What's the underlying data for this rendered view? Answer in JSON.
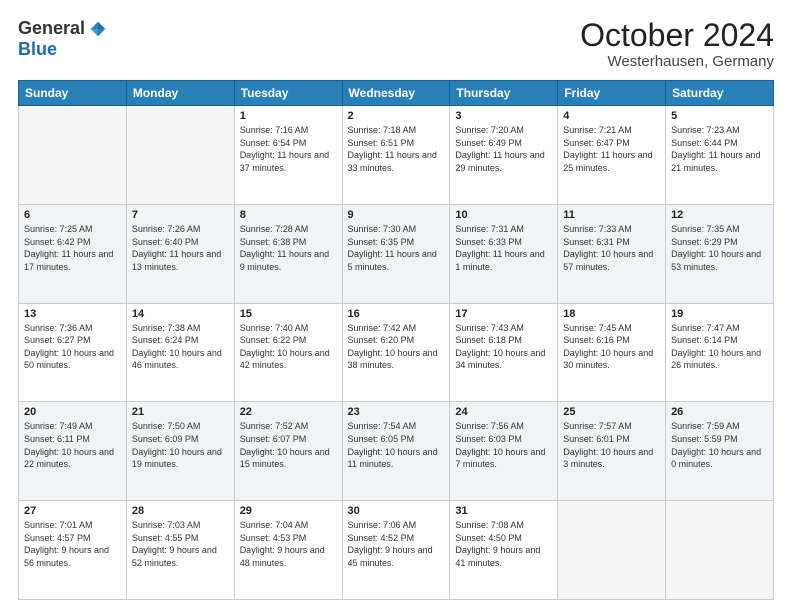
{
  "logo": {
    "general": "General",
    "blue": "Blue"
  },
  "title": "October 2024",
  "subtitle": "Westerhausen, Germany",
  "days_of_week": [
    "Sunday",
    "Monday",
    "Tuesday",
    "Wednesday",
    "Thursday",
    "Friday",
    "Saturday"
  ],
  "weeks": [
    [
      {
        "day": "",
        "info": ""
      },
      {
        "day": "",
        "info": ""
      },
      {
        "day": "1",
        "info": "Sunrise: 7:16 AM\nSunset: 6:54 PM\nDaylight: 11 hours and 37 minutes."
      },
      {
        "day": "2",
        "info": "Sunrise: 7:18 AM\nSunset: 6:51 PM\nDaylight: 11 hours and 33 minutes."
      },
      {
        "day": "3",
        "info": "Sunrise: 7:20 AM\nSunset: 6:49 PM\nDaylight: 11 hours and 29 minutes."
      },
      {
        "day": "4",
        "info": "Sunrise: 7:21 AM\nSunset: 6:47 PM\nDaylight: 11 hours and 25 minutes."
      },
      {
        "day": "5",
        "info": "Sunrise: 7:23 AM\nSunset: 6:44 PM\nDaylight: 11 hours and 21 minutes."
      }
    ],
    [
      {
        "day": "6",
        "info": "Sunrise: 7:25 AM\nSunset: 6:42 PM\nDaylight: 11 hours and 17 minutes."
      },
      {
        "day": "7",
        "info": "Sunrise: 7:26 AM\nSunset: 6:40 PM\nDaylight: 11 hours and 13 minutes."
      },
      {
        "day": "8",
        "info": "Sunrise: 7:28 AM\nSunset: 6:38 PM\nDaylight: 11 hours and 9 minutes."
      },
      {
        "day": "9",
        "info": "Sunrise: 7:30 AM\nSunset: 6:35 PM\nDaylight: 11 hours and 5 minutes."
      },
      {
        "day": "10",
        "info": "Sunrise: 7:31 AM\nSunset: 6:33 PM\nDaylight: 11 hours and 1 minute."
      },
      {
        "day": "11",
        "info": "Sunrise: 7:33 AM\nSunset: 6:31 PM\nDaylight: 10 hours and 57 minutes."
      },
      {
        "day": "12",
        "info": "Sunrise: 7:35 AM\nSunset: 6:29 PM\nDaylight: 10 hours and 53 minutes."
      }
    ],
    [
      {
        "day": "13",
        "info": "Sunrise: 7:36 AM\nSunset: 6:27 PM\nDaylight: 10 hours and 50 minutes."
      },
      {
        "day": "14",
        "info": "Sunrise: 7:38 AM\nSunset: 6:24 PM\nDaylight: 10 hours and 46 minutes."
      },
      {
        "day": "15",
        "info": "Sunrise: 7:40 AM\nSunset: 6:22 PM\nDaylight: 10 hours and 42 minutes."
      },
      {
        "day": "16",
        "info": "Sunrise: 7:42 AM\nSunset: 6:20 PM\nDaylight: 10 hours and 38 minutes."
      },
      {
        "day": "17",
        "info": "Sunrise: 7:43 AM\nSunset: 6:18 PM\nDaylight: 10 hours and 34 minutes."
      },
      {
        "day": "18",
        "info": "Sunrise: 7:45 AM\nSunset: 6:16 PM\nDaylight: 10 hours and 30 minutes."
      },
      {
        "day": "19",
        "info": "Sunrise: 7:47 AM\nSunset: 6:14 PM\nDaylight: 10 hours and 26 minutes."
      }
    ],
    [
      {
        "day": "20",
        "info": "Sunrise: 7:49 AM\nSunset: 6:11 PM\nDaylight: 10 hours and 22 minutes."
      },
      {
        "day": "21",
        "info": "Sunrise: 7:50 AM\nSunset: 6:09 PM\nDaylight: 10 hours and 19 minutes."
      },
      {
        "day": "22",
        "info": "Sunrise: 7:52 AM\nSunset: 6:07 PM\nDaylight: 10 hours and 15 minutes."
      },
      {
        "day": "23",
        "info": "Sunrise: 7:54 AM\nSunset: 6:05 PM\nDaylight: 10 hours and 11 minutes."
      },
      {
        "day": "24",
        "info": "Sunrise: 7:56 AM\nSunset: 6:03 PM\nDaylight: 10 hours and 7 minutes."
      },
      {
        "day": "25",
        "info": "Sunrise: 7:57 AM\nSunset: 6:01 PM\nDaylight: 10 hours and 3 minutes."
      },
      {
        "day": "26",
        "info": "Sunrise: 7:59 AM\nSunset: 5:59 PM\nDaylight: 10 hours and 0 minutes."
      }
    ],
    [
      {
        "day": "27",
        "info": "Sunrise: 7:01 AM\nSunset: 4:57 PM\nDaylight: 9 hours and 56 minutes."
      },
      {
        "day": "28",
        "info": "Sunrise: 7:03 AM\nSunset: 4:55 PM\nDaylight: 9 hours and 52 minutes."
      },
      {
        "day": "29",
        "info": "Sunrise: 7:04 AM\nSunset: 4:53 PM\nDaylight: 9 hours and 48 minutes."
      },
      {
        "day": "30",
        "info": "Sunrise: 7:06 AM\nSunset: 4:52 PM\nDaylight: 9 hours and 45 minutes."
      },
      {
        "day": "31",
        "info": "Sunrise: 7:08 AM\nSunset: 4:50 PM\nDaylight: 9 hours and 41 minutes."
      },
      {
        "day": "",
        "info": ""
      },
      {
        "day": "",
        "info": ""
      }
    ]
  ]
}
